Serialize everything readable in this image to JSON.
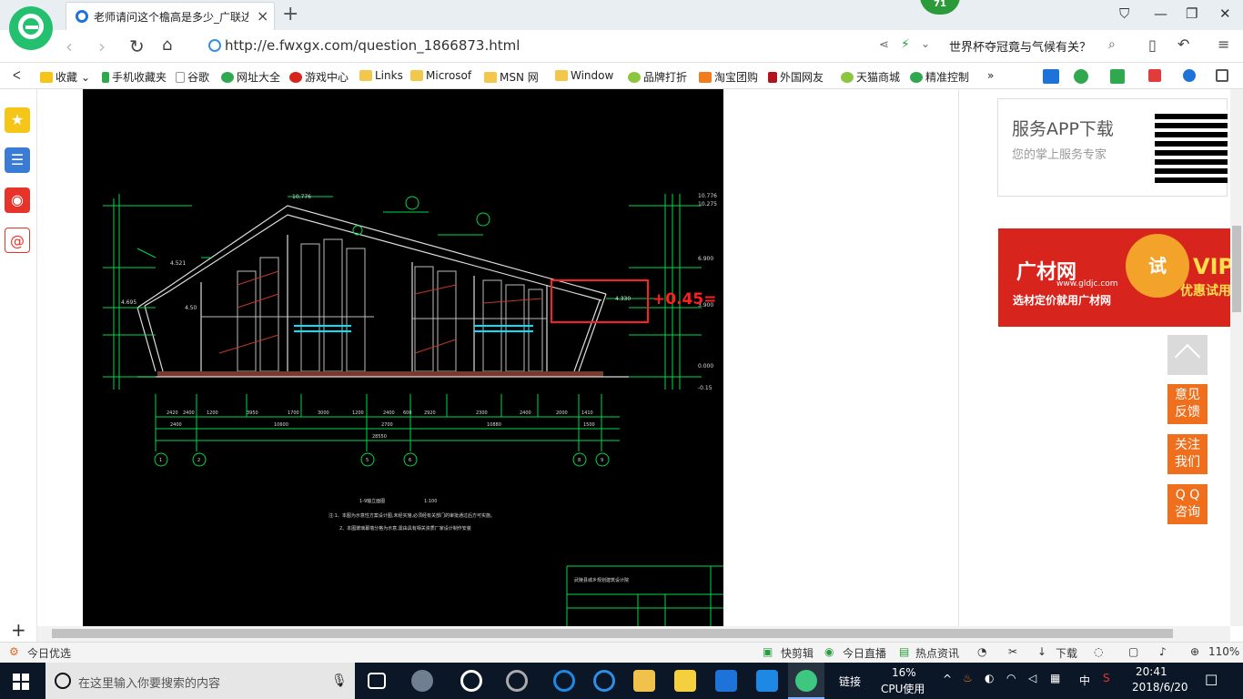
{
  "tab": {
    "title": "老师请问这个檐高是多少_广联达",
    "close": "×",
    "new": "+"
  },
  "badge": "71",
  "address": {
    "url": "http://e.fwxgx.com/question_1866873.html",
    "search_text": "世界杯夺冠竟与气候有关？"
  },
  "bookmarks": [
    {
      "label": "收藏",
      "arrow": "⌄"
    },
    {
      "label": "手机收藏夹"
    },
    {
      "label": "谷歌"
    },
    {
      "label": "网址大全"
    },
    {
      "label": "游戏中心"
    },
    {
      "label": "Links"
    },
    {
      "label": "Microsof"
    },
    {
      "label": "MSN 网"
    },
    {
      "label": "Window"
    },
    {
      "label": "品牌打折"
    },
    {
      "label": "淘宝团购"
    },
    {
      "label": "外国网友"
    },
    {
      "label": "天猫商城"
    },
    {
      "label": "精准控制"
    }
  ],
  "bm_more": "»",
  "app_box": {
    "title": "服务APP下载",
    "subtitle": "您的掌上服务专家"
  },
  "ad": {
    "brand": "广材网",
    "url": "www.gldjc.com",
    "slogan": "选材定价就用广材网",
    "circle": "试",
    "vip": "VIP",
    "vip_sub": "优惠试用"
  },
  "side_buttons": [
    {
      "label": "意见\n反馈"
    },
    {
      "label": "关注\n我们"
    },
    {
      "label": "Q Q\n咨询"
    }
  ],
  "cad": {
    "annotation": "+0.45=",
    "elev": [
      "10.776",
      "10.275",
      "6.900",
      "4.330",
      "4.521",
      "4.695",
      "0.000",
      "-0.15",
      "3.900",
      "4.50"
    ],
    "dims_top": [
      "2420",
      "2400",
      "1200",
      "3950",
      "1700",
      "3000",
      "1200",
      "2400",
      "600",
      "2920",
      "2300",
      "2400",
      "2000",
      "1410"
    ],
    "dims_mid": [
      "2400",
      "10600",
      "2700",
      "10880",
      "1500"
    ],
    "dims_total": "28550",
    "axes": [
      "1",
      "2",
      "5",
      "6",
      "8",
      "9"
    ],
    "drawing_title": "1-9轴立面图",
    "scale": "1:100",
    "notes": [
      "注:1、本图为示意性方案设计图,未经实施,必须经有关部门的审批通过后方可实施。",
      "2、本图玻璃幕墙分格为示意,需由具有相关资质厂家设计制作安装"
    ],
    "titleblock": "武陵县城乡规划建筑设计院"
  },
  "status": {
    "left": "今日优选",
    "items": [
      "快剪辑",
      "今日直播",
      "热点资讯",
      "下载"
    ],
    "zoom": "110%"
  },
  "taskbar": {
    "search_placeholder": "在这里输入你要搜索的内容",
    "link": "链接",
    "cpu_pct": "16%",
    "cpu_label": "CPU使用",
    "ime": "中",
    "time": "20:41",
    "date": "2018/6/20"
  }
}
